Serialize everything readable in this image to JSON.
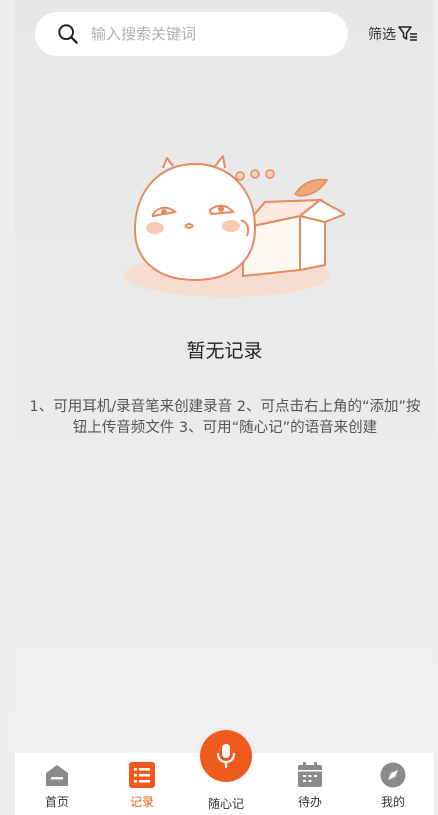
{
  "search": {
    "placeholder": "输入搜索关键词"
  },
  "filter": {
    "label": "筛选"
  },
  "empty": {
    "title": "暂无记录",
    "description": "1、可用耳机/录音笔来创建录音 2、可点击右上角的“添加”按钮上传音频文件 3、可用“随心记”的语音来创建"
  },
  "nav": {
    "home": "首页",
    "records": "记录",
    "quick_note": "随心记",
    "todo": "待办",
    "mine": "我的"
  },
  "colors": {
    "accent": "#f15a1f",
    "inactive_icon": "#8a8a8a"
  }
}
